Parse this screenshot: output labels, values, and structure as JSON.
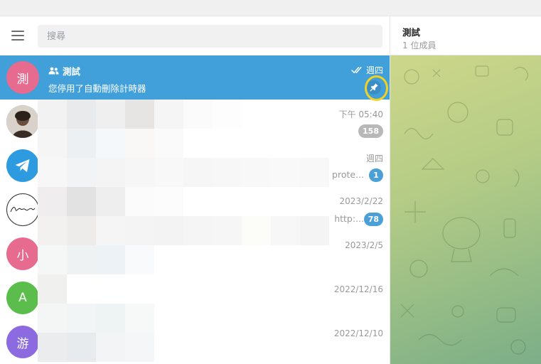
{
  "search": {
    "placeholder": "搜尋"
  },
  "chats": [
    {
      "avatar": "測",
      "avatar_color": "#e76a8f",
      "title": "測試",
      "preview": "您停用了自動刪除計時器",
      "time": "週四",
      "read": true,
      "pinned": true,
      "active": true
    },
    {
      "avatar": "",
      "avatar_color": "#8a7a6a",
      "time": "下午 05:40",
      "badge": "158",
      "badge_style": "muted",
      "snippet": ""
    },
    {
      "avatar": "",
      "avatar_color": "#2e9be0",
      "time": "週四",
      "badge": "1",
      "badge_style": "blue",
      "snippet": "prote..."
    },
    {
      "avatar": "",
      "avatar_color": "#ffffff",
      "time": "2023/2/22",
      "badge": "78",
      "badge_style": "blue",
      "snippet": "http:..."
    },
    {
      "avatar": "小",
      "avatar_color": "#e76a8f",
      "time": "2023/2/5"
    },
    {
      "avatar": "A",
      "avatar_color": "#5bbd4c",
      "time": "2022/12/16"
    },
    {
      "avatar": "游",
      "avatar_color": "#8c6be0",
      "time": "2022/12/10"
    }
  ],
  "header": {
    "title": "測試",
    "subtitle": "1 位成員"
  },
  "colors": {
    "active_row": "#419fd9",
    "highlight_ring": "#f3d21e",
    "annotation_arrow": "#e01d1d",
    "badge_muted": "#b8b8b8",
    "badge_blue": "#4ca0d8"
  },
  "icons": [
    "menu-icon",
    "group-icon",
    "double-check-icon",
    "pin-icon",
    "telegram-logo-icon",
    "annotation-arrow-icon"
  ]
}
